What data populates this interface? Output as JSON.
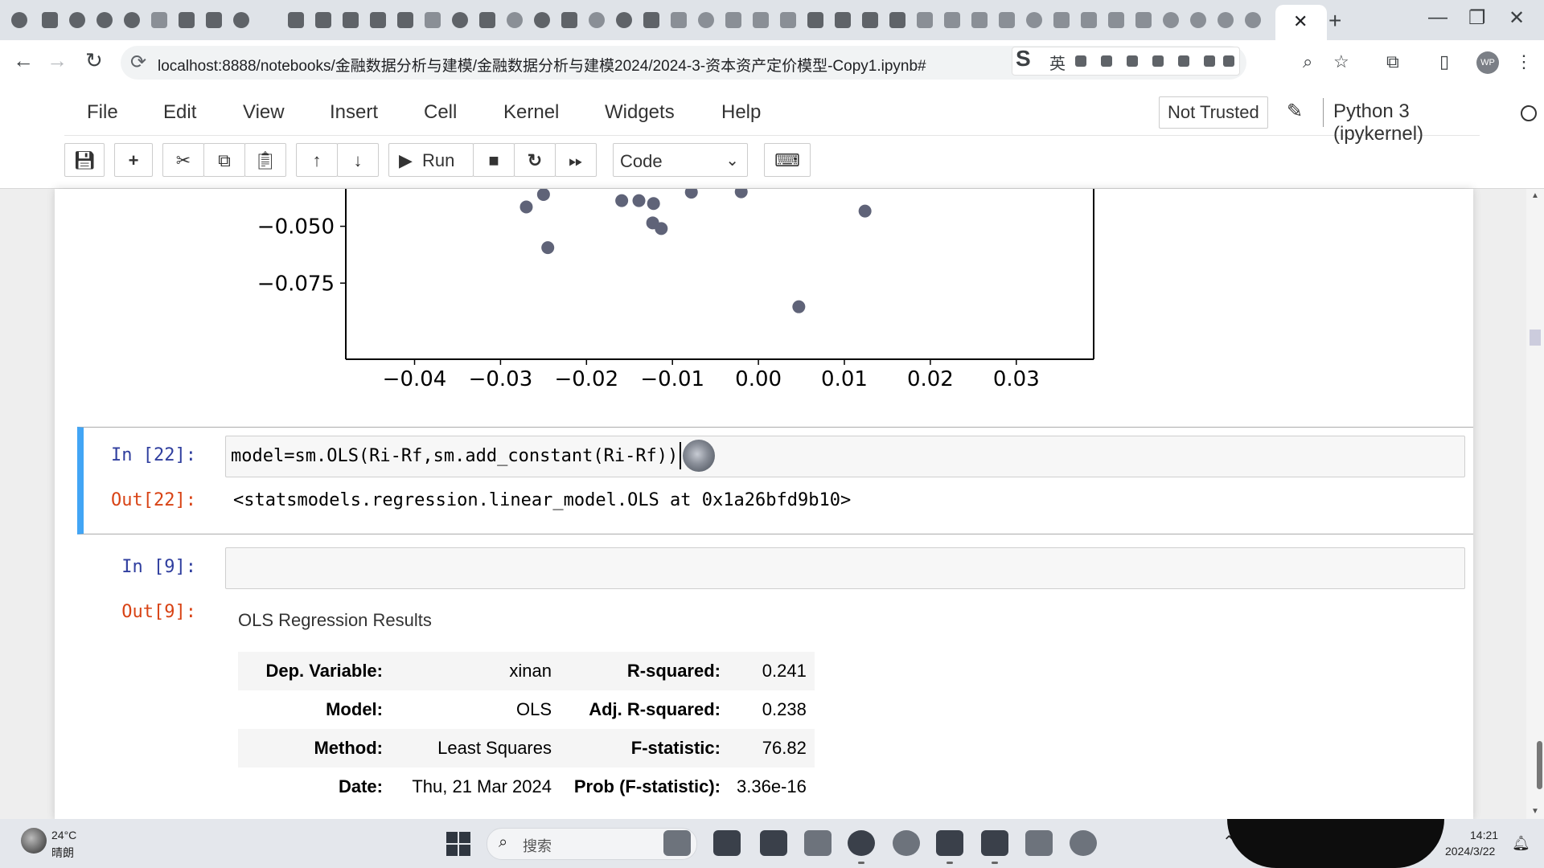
{
  "browser": {
    "tab_close": "✕",
    "new_tab": "+",
    "url": "localhost:8888/notebooks/金融数据分析与建模/金融数据分析与建模2024/2024-3-资本资产定价模型-Copy1.ipynb#",
    "ime_logo": "S",
    "ime_lang": "英",
    "profile": "WP",
    "win_minimize": "—",
    "win_maximize": "❐",
    "win_close": "✕"
  },
  "menubar": {
    "items": [
      "File",
      "Edit",
      "View",
      "Insert",
      "Cell",
      "Kernel",
      "Widgets",
      "Help"
    ],
    "trust": "Not Trusted",
    "kernel": "Python 3 (ipykernel)"
  },
  "toolbar": {
    "run_label": "Run",
    "cell_type": "Code"
  },
  "chart_data": {
    "type": "scatter",
    "title": "",
    "xlabel": "",
    "ylabel": "",
    "x_ticks": [
      "−0.04",
      "−0.03",
      "−0.02",
      "−0.01",
      "0.00",
      "0.01",
      "0.02",
      "0.03"
    ],
    "y_ticks": [
      "−0.050",
      "−0.075"
    ],
    "xlim": [
      -0.048,
      0.039
    ],
    "visible_ylim": [
      -0.1085,
      -0.03
    ],
    "point_color": "#5f6378",
    "points": [
      {
        "x": -0.027,
        "y": -0.0415
      },
      {
        "x": -0.025,
        "y": -0.036
      },
      {
        "x": -0.0245,
        "y": -0.0594
      },
      {
        "x": -0.0159,
        "y": -0.0387
      },
      {
        "x": -0.0139,
        "y": -0.0387
      },
      {
        "x": -0.0122,
        "y": -0.04
      },
      {
        "x": -0.0123,
        "y": -0.0485
      },
      {
        "x": -0.0113,
        "y": -0.051
      },
      {
        "x": -0.0078,
        "y": -0.035
      },
      {
        "x": -0.002,
        "y": -0.0348
      },
      {
        "x": 0.0124,
        "y": -0.0433
      },
      {
        "x": 0.0047,
        "y": -0.0854
      }
    ]
  },
  "cells": {
    "c22": {
      "in_prompt": "In  [22]:",
      "code": "model=sm.OLS(Ri-Rf,sm.add_constant(Ri-Rf))",
      "out_prompt": "Out[22]:",
      "output": "<statsmodels.regression.linear_model.OLS at 0x1a26bfd9b10>"
    },
    "c9": {
      "in_prompt": "In  [9]:",
      "code": "",
      "out_prompt": "Out[9]:",
      "table_title": "OLS Regression Results",
      "rows": [
        [
          "Dep. Variable:",
          "xinan",
          "R-squared:",
          "0.241"
        ],
        [
          "Model:",
          "OLS",
          "Adj. R-squared:",
          "0.238"
        ],
        [
          "Method:",
          "Least Squares",
          "F-statistic:",
          "76.82"
        ],
        [
          "Date:",
          "Thu, 21 Mar 2024",
          "Prob (F-statistic):",
          "3.36e-16"
        ]
      ]
    }
  },
  "taskbar": {
    "weather_temp": "24°C",
    "weather_desc": "晴朗",
    "search_placeholder": "搜索",
    "time": "14:21",
    "date": "2024/3/22"
  }
}
